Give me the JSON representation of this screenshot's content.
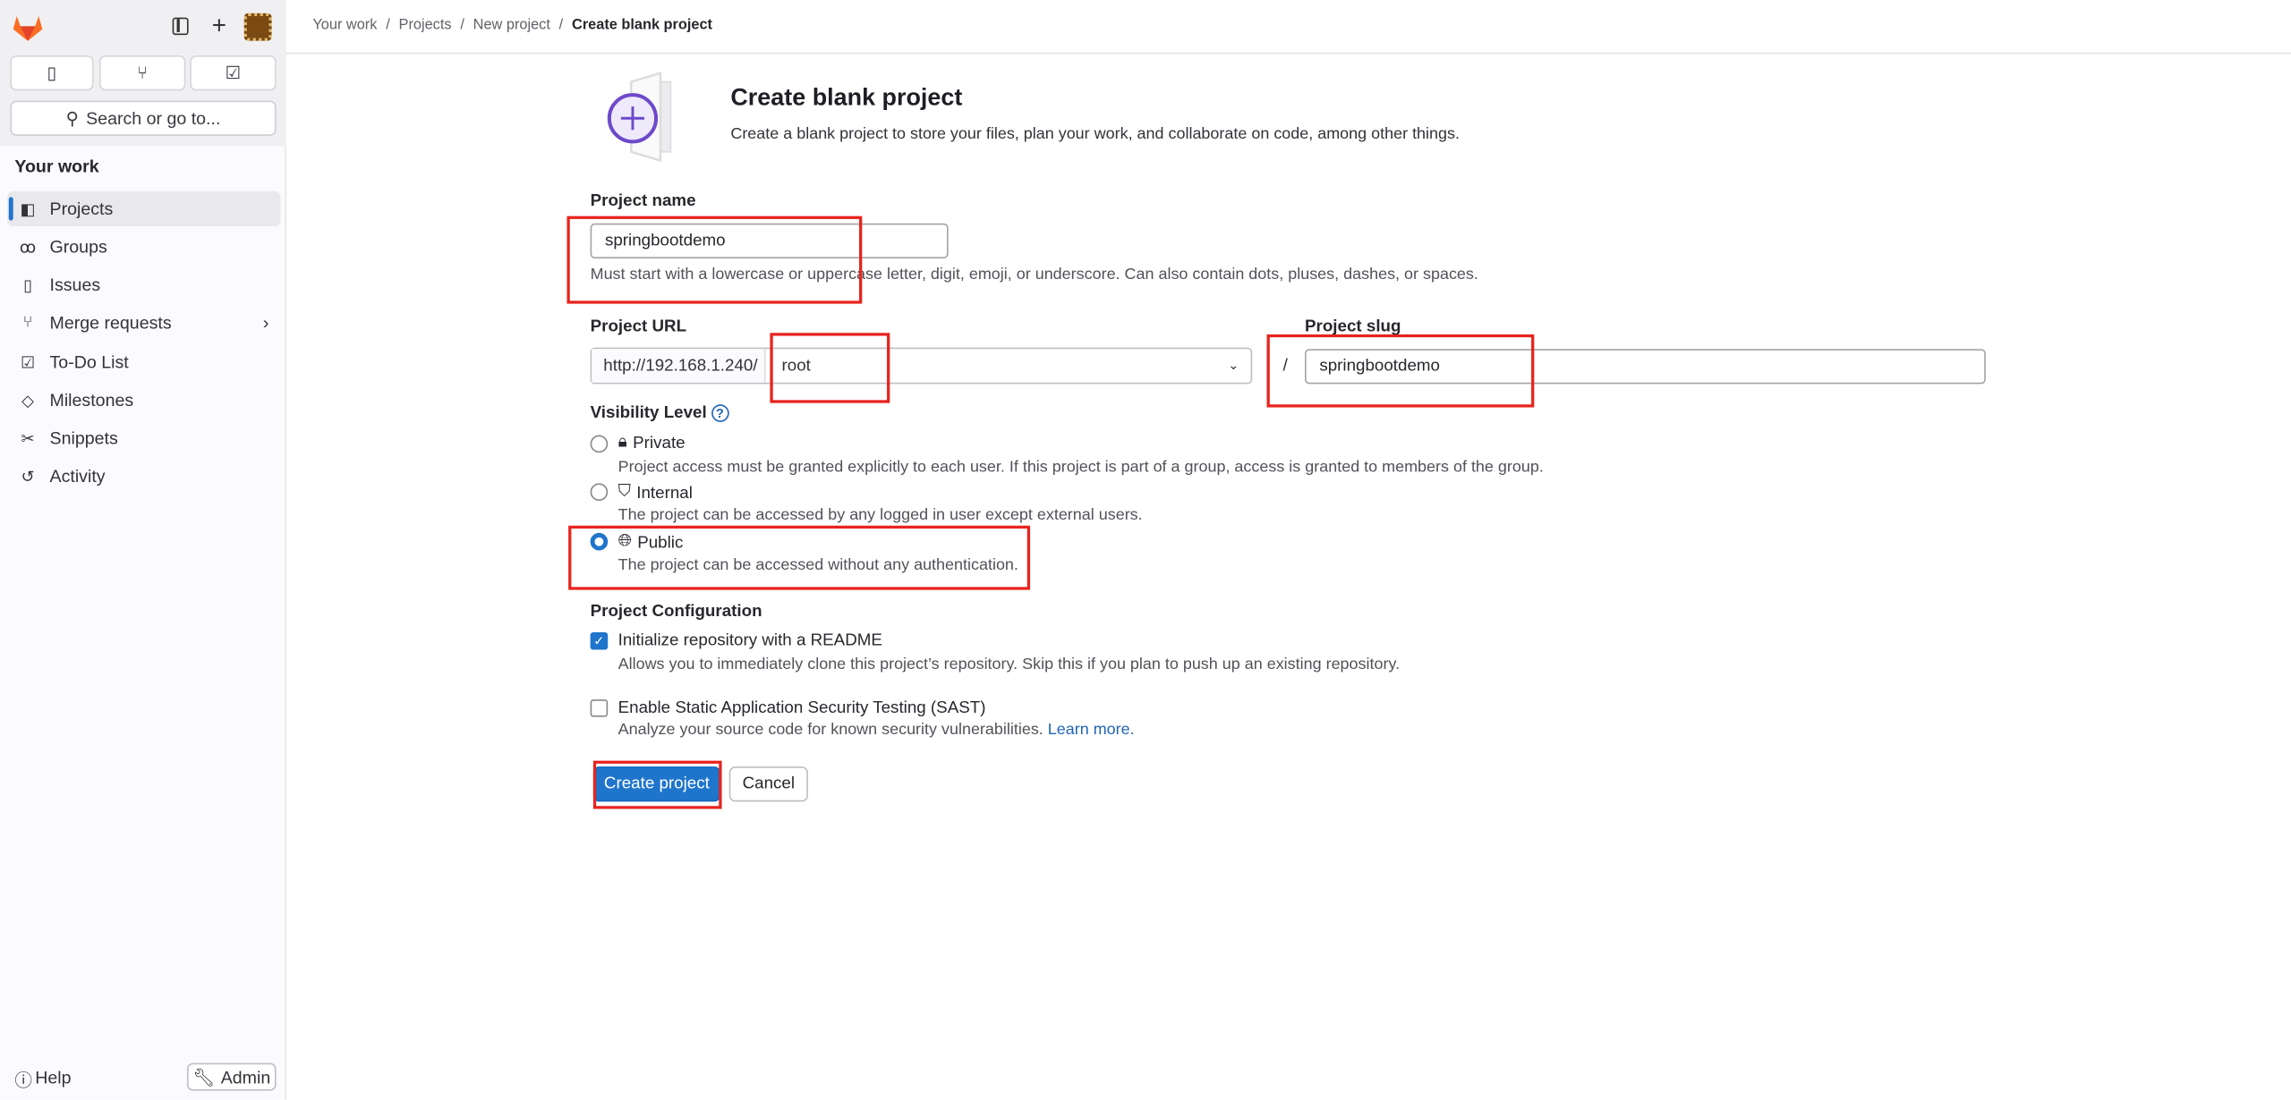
{
  "sidebar": {
    "top_buttons": [
      {
        "icon": "issues-icon"
      },
      {
        "icon": "merge-request-icon"
      },
      {
        "icon": "todo-icon"
      }
    ],
    "search_placeholder": "Search or go to...",
    "section_title": "Your work",
    "items": [
      {
        "label": "Projects",
        "icon": "project-icon",
        "active": true
      },
      {
        "label": "Groups",
        "icon": "group-icon"
      },
      {
        "label": "Issues",
        "icon": "issues-icon"
      },
      {
        "label": "Merge requests",
        "icon": "merge-request-icon",
        "has_chevron": true
      },
      {
        "label": "To-Do List",
        "icon": "todo-icon"
      },
      {
        "label": "Milestones",
        "icon": "milestone-icon"
      },
      {
        "label": "Snippets",
        "icon": "snippet-icon"
      },
      {
        "label": "Activity",
        "icon": "history-icon"
      }
    ],
    "help_label": "Help",
    "admin_label": "Admin"
  },
  "breadcrumb": [
    "Your work",
    "Projects",
    "New project",
    "Create blank project"
  ],
  "page": {
    "title": "Create blank project",
    "description": "Create a blank project to store your files, plan your work, and collaborate on code, among other things."
  },
  "form": {
    "project_name_label": "Project name",
    "project_name_value": "springbootdemo",
    "project_name_help": "Must start with a lowercase or uppercase letter, digit, emoji, or underscore. Can also contain dots, pluses, dashes, or spaces.",
    "project_url_label": "Project URL",
    "url_prefix": "http://192.168.1.240/",
    "namespace_value": "root",
    "slug_separator": "/",
    "project_slug_label": "Project slug",
    "project_slug_value": "springbootdemo",
    "visibility_label": "Visibility Level",
    "visibility_options": [
      {
        "label": "Private",
        "icon": "lock-icon",
        "description": "Project access must be granted explicitly to each user. If this project is part of a group, access is granted to members of the group.",
        "selected": false
      },
      {
        "label": "Internal",
        "icon": "shield-icon",
        "description": "The project can be accessed by any logged in user except external users.",
        "selected": false
      },
      {
        "label": "Public",
        "icon": "earth-icon",
        "description": "The project can be accessed without any authentication.",
        "selected": true
      }
    ],
    "config_label": "Project Configuration",
    "readme_label": "Initialize repository with a README",
    "readme_checked": true,
    "readme_help": "Allows you to immediately clone this project’s repository. Skip this if you plan to push up an existing repository.",
    "sast_label": "Enable Static Application Security Testing (SAST)",
    "sast_checked": false,
    "sast_help": "Analyze your source code for known security vulnerabilities.",
    "sast_link": "Learn more.",
    "create_label": "Create project",
    "cancel_label": "Cancel"
  },
  "colors": {
    "primary": "#1f75cb",
    "annotation": "#e8231d",
    "brand_orange": "#fc6d26"
  }
}
